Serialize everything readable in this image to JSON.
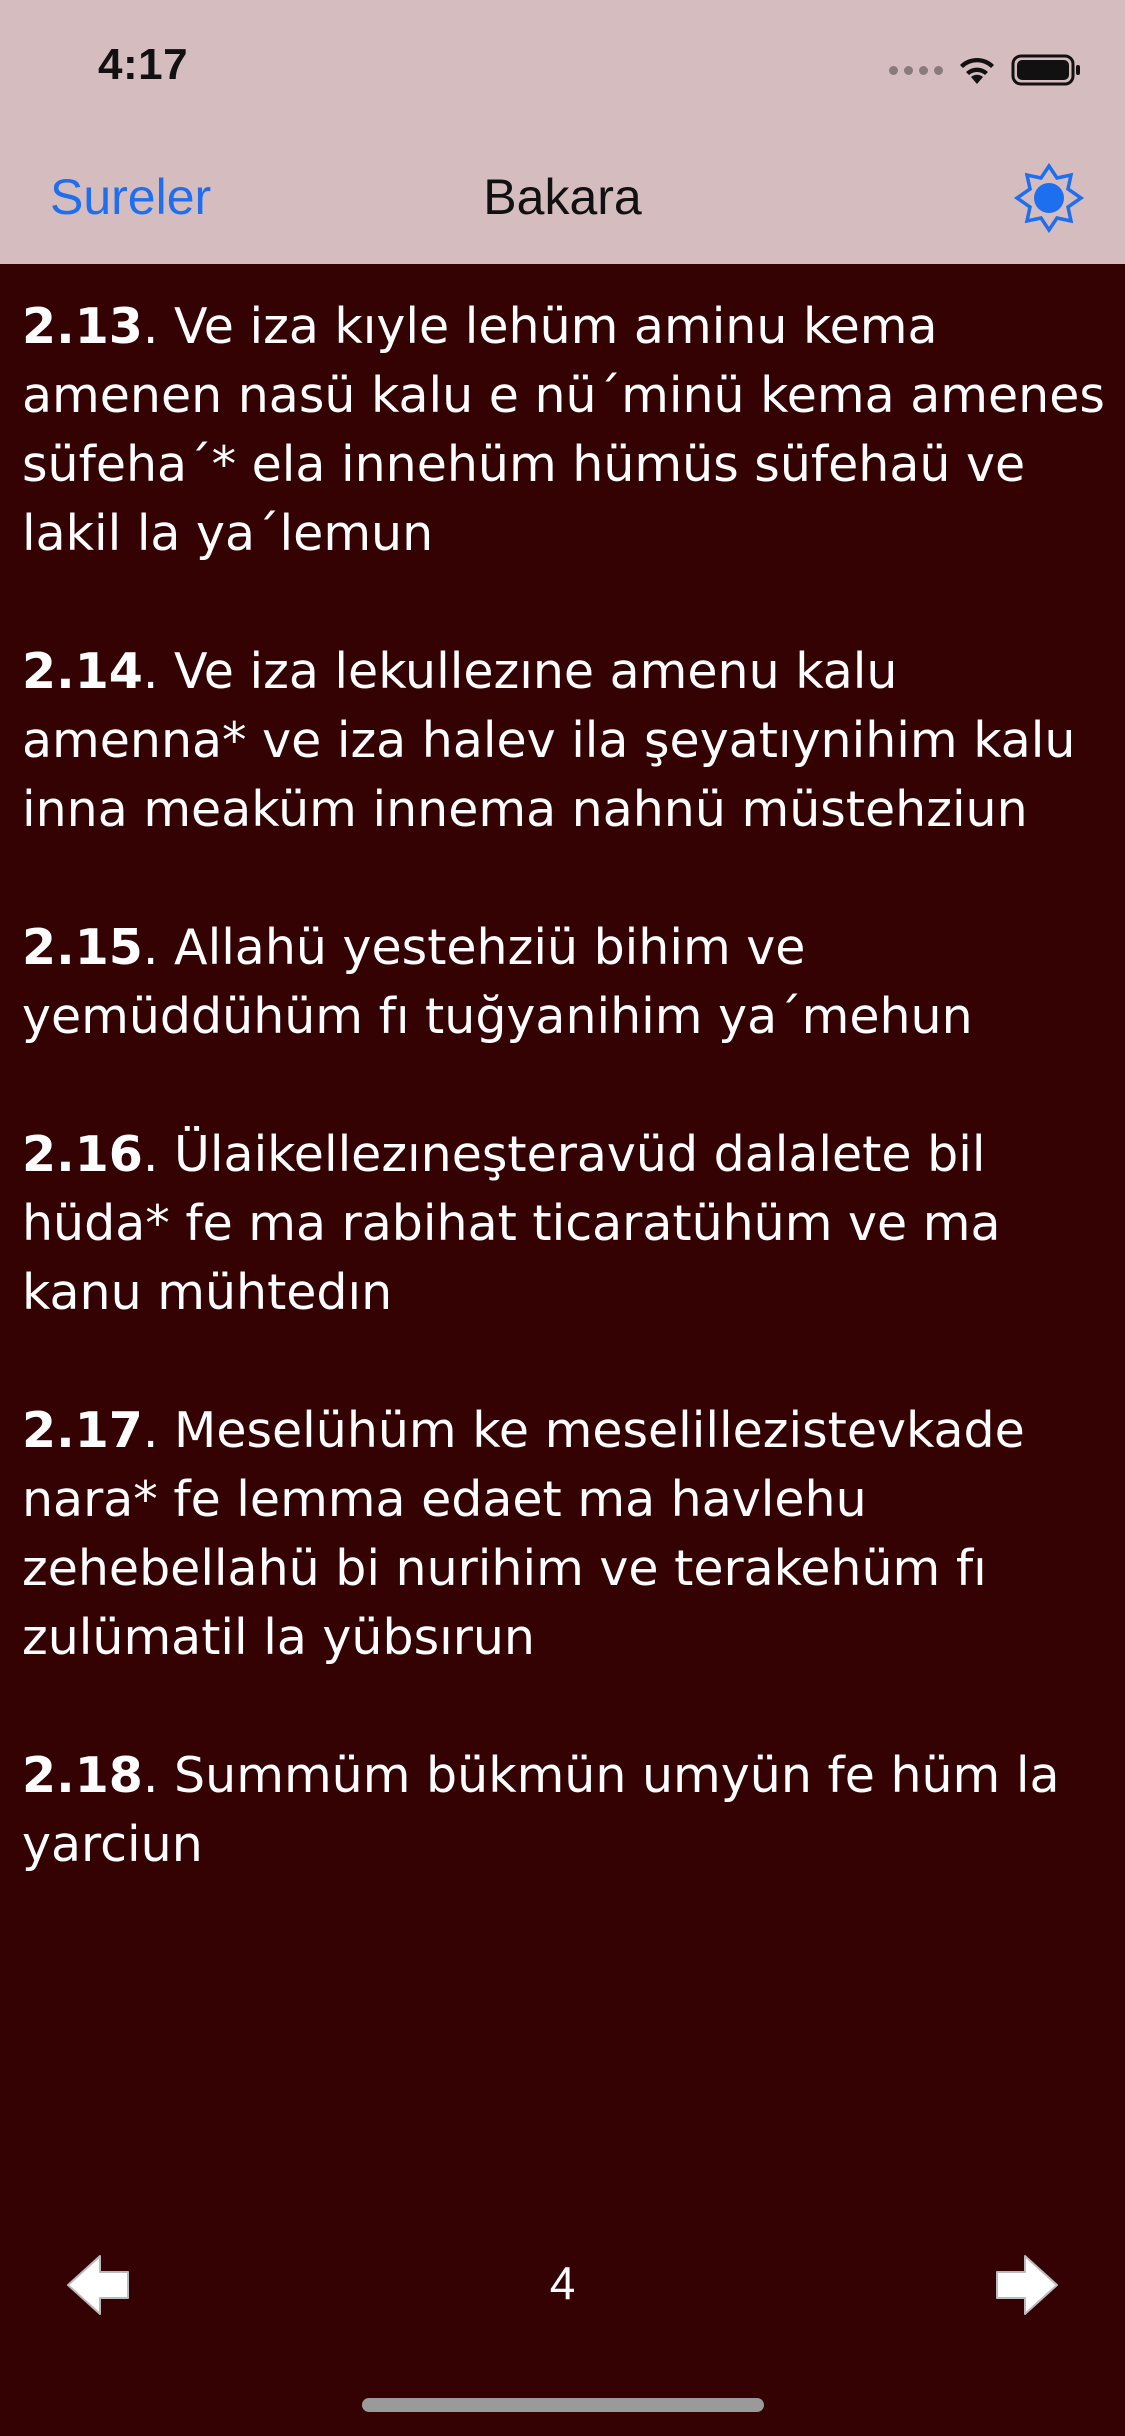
{
  "status_bar": {
    "time": "4:17"
  },
  "nav": {
    "back_label": "Sureler",
    "title": "Bakara"
  },
  "verses": [
    {
      "number": "2.13",
      "text": ". Ve iza kıyle lehüm aminu kema amenen nasü kalu e nü´minü kema amenes süfeha´* ela innehüm hümüs süfehaü ve lakil la ya´lemun"
    },
    {
      "number": "2.14",
      "text": ". Ve iza lekullezıne amenu kalu amenna* ve iza halev ila şeyatıynihim kalu inna meaküm innema nahnü müstehziun"
    },
    {
      "number": "2.15",
      "text": ". Allahü yestehziü bihim ve yemüddühüm fı tuğyanihim ya´mehun"
    },
    {
      "number": "2.16",
      "text": ". Ülaikellezıneşteravüd dalalete bil hüda* fe ma rabihat ticaratühüm ve ma kanu mühtedın"
    },
    {
      "number": "2.17",
      "text": ". Meselühüm ke meselillezistevkade nara* fe lemma edaet ma havlehu zehebellahü bi nurihim ve terakehüm fı zulümatil la yübsırun"
    },
    {
      "number": "2.18",
      "text": ". Summüm bükmün umyün fe hüm la yarciun"
    }
  ],
  "footer": {
    "page_number": "4",
    "prev_icon": "arrow-left-icon",
    "next_icon": "arrow-right-icon"
  },
  "colors": {
    "header_bg": "#d5bdbf",
    "content_bg": "#350204",
    "accent": "#1e6ef0",
    "text": "#ffffff"
  }
}
